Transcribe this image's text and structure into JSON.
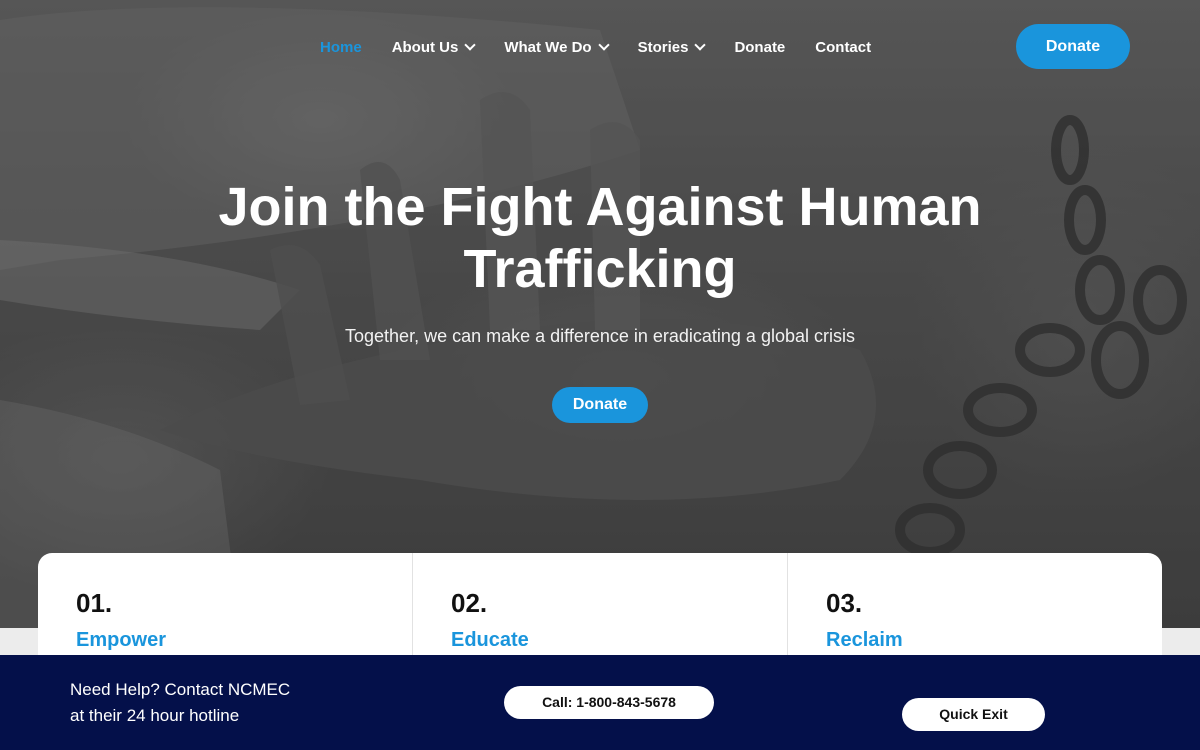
{
  "nav": {
    "items": [
      {
        "label": "Home",
        "active": true,
        "dropdown": false
      },
      {
        "label": "About Us",
        "active": false,
        "dropdown": true
      },
      {
        "label": "What We Do",
        "active": false,
        "dropdown": true
      },
      {
        "label": "Stories",
        "active": false,
        "dropdown": true
      },
      {
        "label": "Donate",
        "active": false,
        "dropdown": false
      },
      {
        "label": "Contact",
        "active": false,
        "dropdown": false
      }
    ],
    "cta_label": "Donate"
  },
  "hero": {
    "title": "Join the Fight Against Human Trafficking",
    "subtitle": "Together, we can make a difference in eradicating a global crisis",
    "button_label": "Donate"
  },
  "cards": [
    {
      "number": "01.",
      "title": "Empower"
    },
    {
      "number": "02.",
      "title": "Educate"
    },
    {
      "number": "03.",
      "title": "Reclaim"
    }
  ],
  "helpbar": {
    "line1": "Need Help? Contact NCMEC",
    "line2": "at their 24 hour hotline",
    "call_label": "Call: 1-800-843-5678",
    "exit_label": "Quick Exit"
  },
  "colors": {
    "accent": "#1a95dc",
    "helpbar_bg": "#04104a",
    "card_bg": "#ffffff"
  },
  "icons": [
    "chevron-down-icon"
  ]
}
